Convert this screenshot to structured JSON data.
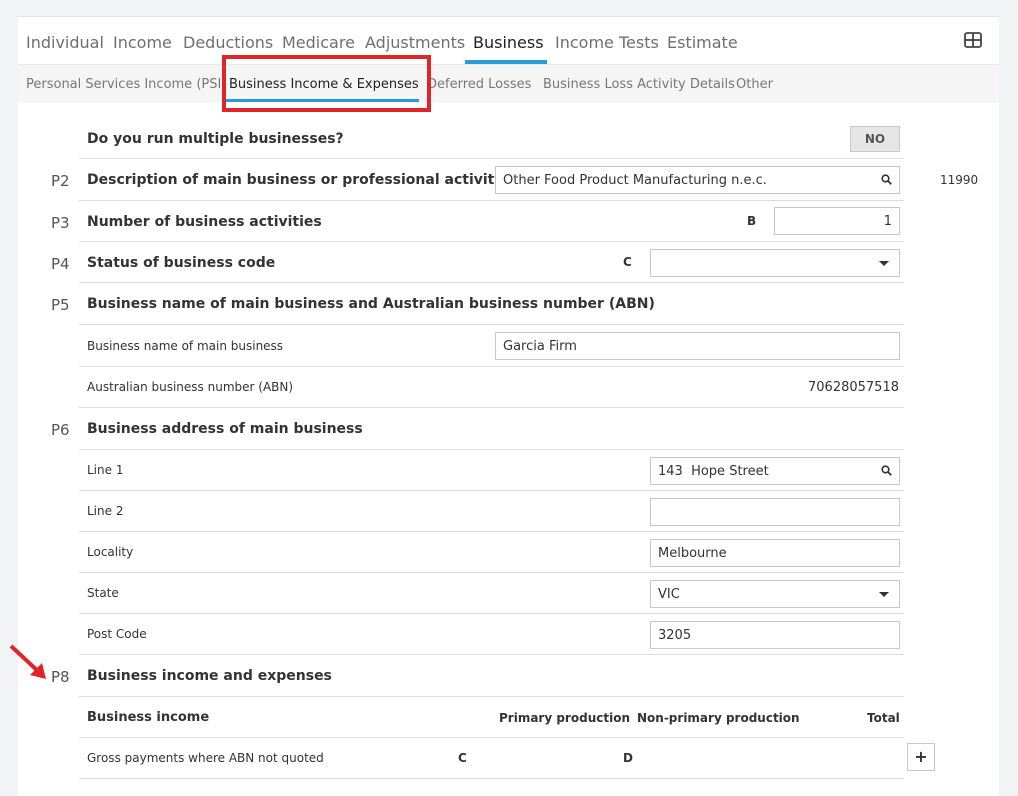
{
  "nav": {
    "tabs": [
      "Individual",
      "Income",
      "Deductions",
      "Medicare",
      "Adjustments",
      "Business",
      "Income Tests",
      "Estimate"
    ],
    "active_tab": "Business"
  },
  "subnav": {
    "tabs": [
      "Personal Services Income (PSI)",
      "Business Income & Expenses",
      "Deferred Losses",
      "Business Loss Activity Details",
      "Other"
    ],
    "active_tab": "Business Income & Expenses"
  },
  "form": {
    "multiple": {
      "label": "Do you run multiple businesses?",
      "button": "NO"
    },
    "p2": {
      "code": "P2",
      "label": "Description of main business or professional activity",
      "value": "Other Food Product Manufacturing n.e.c.",
      "anzsic": "11990"
    },
    "p3": {
      "code": "P3",
      "label": "Number of business activities",
      "letter": "B",
      "value": "1"
    },
    "p4": {
      "code": "P4",
      "label": "Status of business code",
      "letter": "C",
      "value": ""
    },
    "p5": {
      "code": "P5",
      "label": "Business name of main business and Australian business number (ABN)"
    },
    "bizname": {
      "label": "Business name of main business",
      "value": "Garcia Firm"
    },
    "abn": {
      "label": "Australian business number (ABN)",
      "value": "70628057518"
    },
    "p6": {
      "code": "P6",
      "label": "Business address of main business"
    },
    "line1": {
      "label": "Line 1",
      "value": "143  Hope Street"
    },
    "line2": {
      "label": "Line 2",
      "value": ""
    },
    "locality": {
      "label": "Locality",
      "value": "Melbourne"
    },
    "state": {
      "label": "State",
      "value": "VIC"
    },
    "postcode": {
      "label": "Post Code",
      "value": "3205"
    },
    "p8": {
      "code": "P8",
      "label": "Business income and expenses"
    },
    "income_header": {
      "label": "Business income",
      "col_primary": "Primary production",
      "col_nonprimary": "Non-primary production",
      "col_total": "Total"
    },
    "gross": {
      "label": "Gross payments where ABN not quoted",
      "letter_c": "C",
      "letter_d": "D",
      "button": "+"
    }
  },
  "colors": {
    "accent": "#2b9ad8",
    "highlight": "#e0252a",
    "arrow": "#e0252a"
  },
  "icons": [
    "grid-icon",
    "search-icon",
    "chevron-down-icon",
    "arrow-icon"
  ]
}
